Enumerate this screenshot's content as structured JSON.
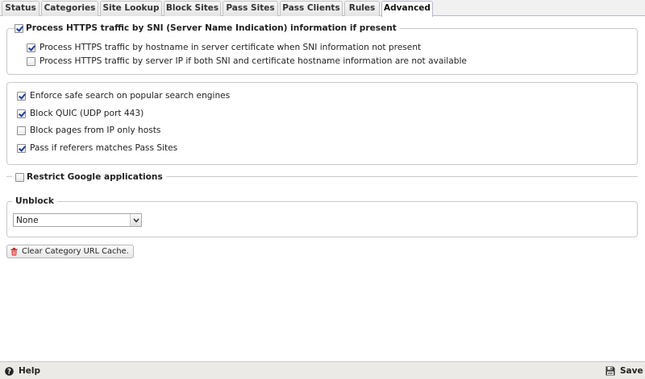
{
  "tabs": [
    {
      "label": "Status",
      "active": false
    },
    {
      "label": "Categories",
      "active": false
    },
    {
      "label": "Site Lookup",
      "active": false
    },
    {
      "label": "Block Sites",
      "active": false
    },
    {
      "label": "Pass Sites",
      "active": false
    },
    {
      "label": "Pass Clients",
      "active": false
    },
    {
      "label": "Rules",
      "active": false
    },
    {
      "label": "Advanced",
      "active": true
    }
  ],
  "sni": {
    "label": "Process HTTPS traffic by SNI (Server Name Indication) information if present",
    "checked": true,
    "options": [
      {
        "label": "Process HTTPS traffic by hostname in server certificate when SNI information not present",
        "checked": true
      },
      {
        "label": "Process HTTPS traffic by server IP if both SNI and certificate hostname information are not available",
        "checked": false
      }
    ]
  },
  "options": [
    {
      "label": "Enforce safe search on popular search engines",
      "checked": true
    },
    {
      "label": "Block QUIC (UDP port 443)",
      "checked": true
    },
    {
      "label": "Block pages from IP only hosts",
      "checked": false
    },
    {
      "label": "Pass if referers matches Pass Sites",
      "checked": true
    }
  ],
  "google": {
    "label": "Restrict Google applications",
    "checked": false
  },
  "unblock": {
    "legend": "Unblock",
    "selected": "None"
  },
  "clear_cache_label": "Clear Category URL Cache.",
  "footer": {
    "help_label": "Help",
    "save_label": "Save"
  }
}
